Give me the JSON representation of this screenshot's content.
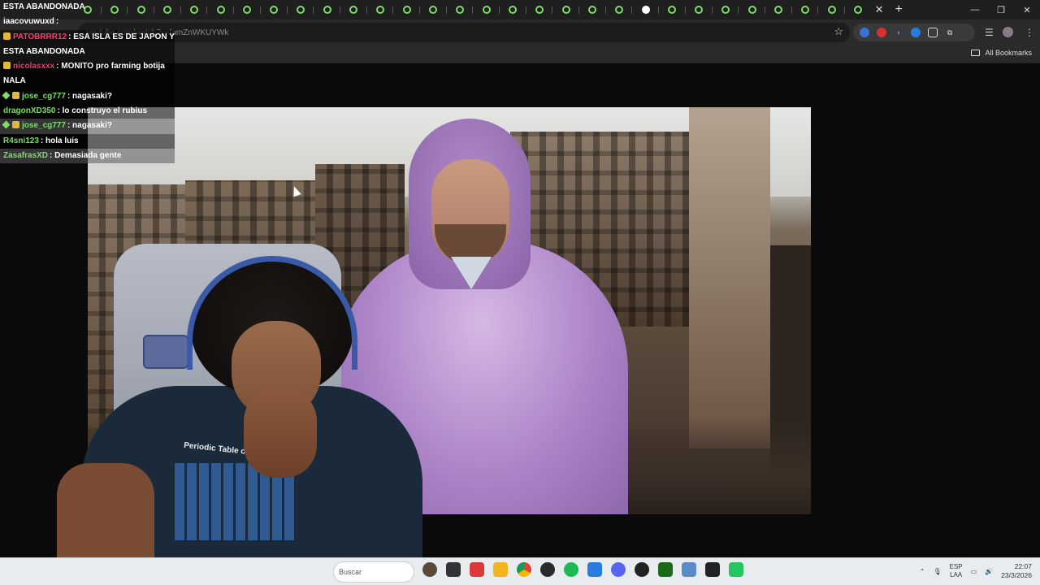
{
  "browser": {
    "url": "youtube.com/watch?v=famZnWKUYWk",
    "bookmarks_label": "All Bookmarks",
    "new_tab": "+",
    "tab_close": "✕"
  },
  "chat": {
    "messages": [
      {
        "user": "",
        "text": "ESTA ABANDONADA",
        "user_color": "#ffffff"
      },
      {
        "user": "iaacovuwuxd",
        "text": ":",
        "user_color": "#ffffff"
      },
      {
        "user": "PATOBRRR12",
        "text": ": ESA ISLA ES DE JAPON Y",
        "user_color": "#ff3a6a"
      },
      {
        "user": "",
        "text": "ESTA ABANDONADA",
        "user_color": "#ffffff"
      },
      {
        "user": "nicolasxxx",
        "text": ": MONITO pro farming botija",
        "user_color": "#ff3a6a"
      },
      {
        "user": "",
        "text": "NALA",
        "user_color": "#ffffff"
      },
      {
        "user": "jose_cg777",
        "text": ": nagasaki?",
        "user_color": "#7ddc6a"
      },
      {
        "user": "dragonXD350",
        "text": ": lo construyo el rubius",
        "user_color": "#7ddc6a"
      },
      {
        "user": "jose_cg777",
        "text": ": nagasaki?",
        "user_color": "#7ddc6a"
      },
      {
        "user": "R4sni123",
        "text": ": hola luis",
        "user_color": "#7ddc6a"
      },
      {
        "user": "ZasafrasXD",
        "text": ": Demasiada gente",
        "user_color": "#7ddc6a"
      }
    ]
  },
  "stream": {
    "shirt_text": "Periodic Table of Min"
  },
  "taskbar": {
    "search_placeholder": "Buscar",
    "lang_top": "ESP",
    "lang_bottom": "LAA",
    "time": "22:07",
    "date": "23/3/2026"
  },
  "colors": {
    "accent_green": "#7ddc6a",
    "chat_red": "#ff3a6a"
  }
}
